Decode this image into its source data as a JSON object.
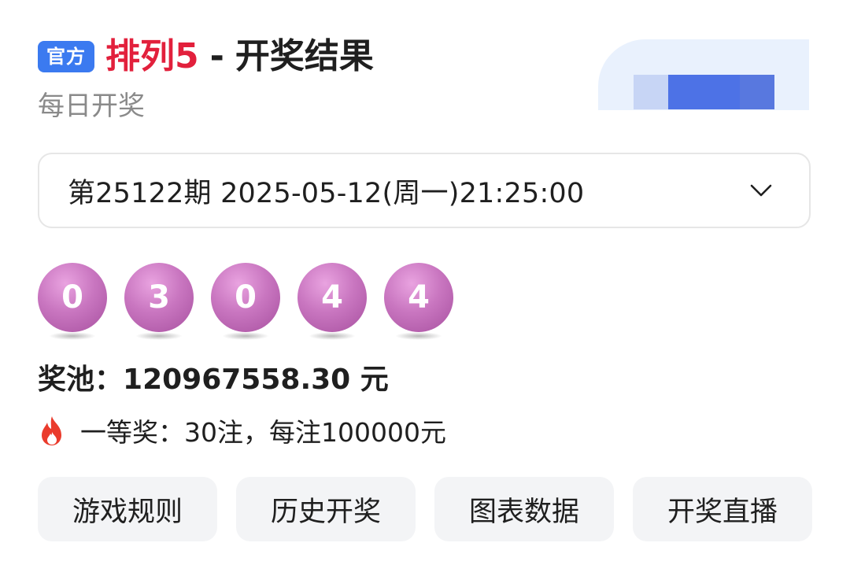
{
  "header": {
    "badge": "官方",
    "game_name": "排列5",
    "separator": "-",
    "title_rest": "开奖结果",
    "subtitle": "每日开奖"
  },
  "draw_selector": {
    "text": "第25122期 2025-05-12(周一)21:25:00",
    "icon": "chevron-down-icon"
  },
  "balls": [
    "0",
    "3",
    "0",
    "4",
    "4"
  ],
  "pool": {
    "label": "奖池：",
    "amount": "120967558.30",
    "unit": "元"
  },
  "first_prize": {
    "icon": "fire-icon",
    "text": "一等奖：30注，每注100000元"
  },
  "buttons": [
    "游戏规则",
    "历史开奖",
    "图表数据",
    "开奖直播"
  ],
  "colors": {
    "badge": "#3b7af0",
    "game_name": "#e2203c",
    "ball": "#c976c0",
    "fire": "#ea3b2c"
  }
}
